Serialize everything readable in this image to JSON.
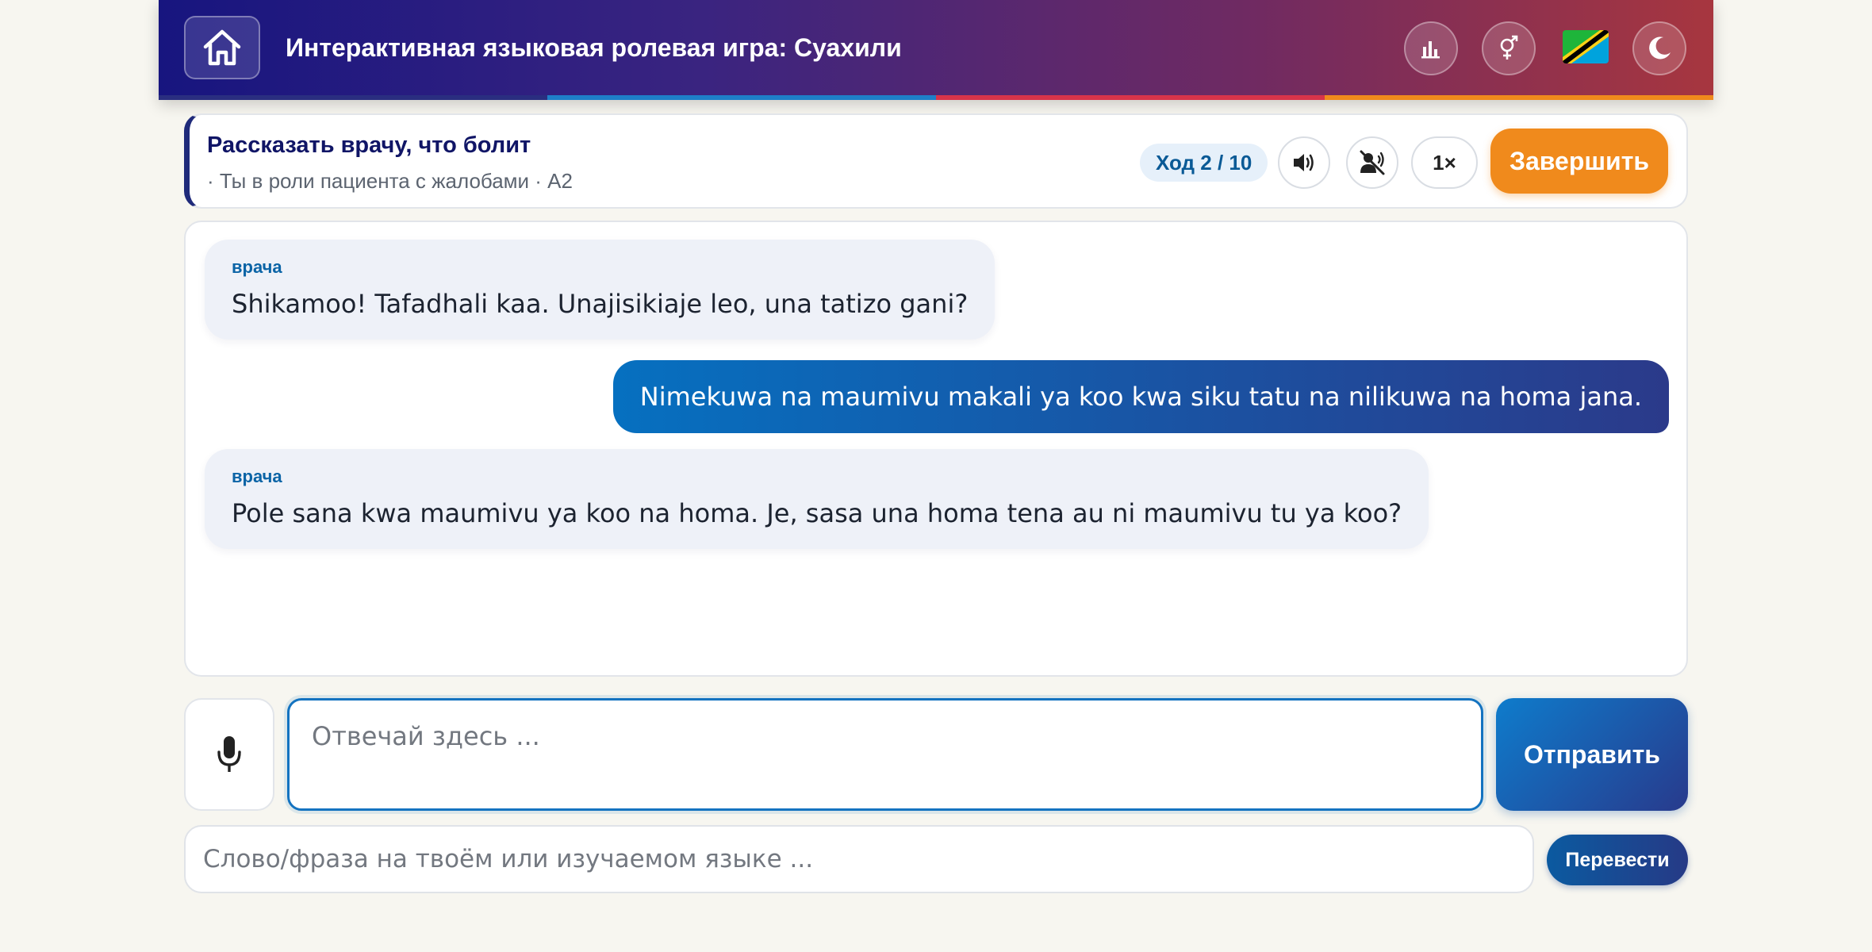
{
  "header": {
    "title": "Интерактивная языковая ролевая игра: Суахили",
    "icons": [
      "home-icon",
      "stats-icon",
      "gender-icon",
      "tanzania-flag-icon",
      "dark-mode-icon"
    ],
    "stripe_colors": [
      "#2a2e80",
      "#1e7fc8",
      "#d8344a",
      "#f08a1c"
    ]
  },
  "scenario": {
    "title": "Рассказать врачу, что болит",
    "subtitle": "· Ты в роли пациента с жалобами · A2",
    "turn": "Ход 2 / 10",
    "speed": "1×",
    "finish_label": "Завершить"
  },
  "chat": {
    "messages": [
      {
        "role": "bot",
        "speaker": "врача",
        "text": "Shikamoo! Tafadhali kaa. Unajisikiaje leo, una tatizo gani?"
      },
      {
        "role": "user",
        "text": "Nimekuwa na maumivu makali ya koo kwa siku tatu na nilikuwa na homa jana."
      },
      {
        "role": "bot",
        "speaker": "врача",
        "text": "Pole sana kwa maumivu ya koo na homa. Je, sasa una homa tena au ni maumivu tu ya koo?"
      }
    ]
  },
  "input": {
    "answer_placeholder": "Отвечай здесь ...",
    "send_label": "Отправить",
    "translate_placeholder": "Слово/фраза на твоём или изучаемом языке ...",
    "translate_label": "Перевести"
  },
  "colors": {
    "accent": "#1473c0",
    "finish": "#f08a1c",
    "title": "#101566"
  }
}
